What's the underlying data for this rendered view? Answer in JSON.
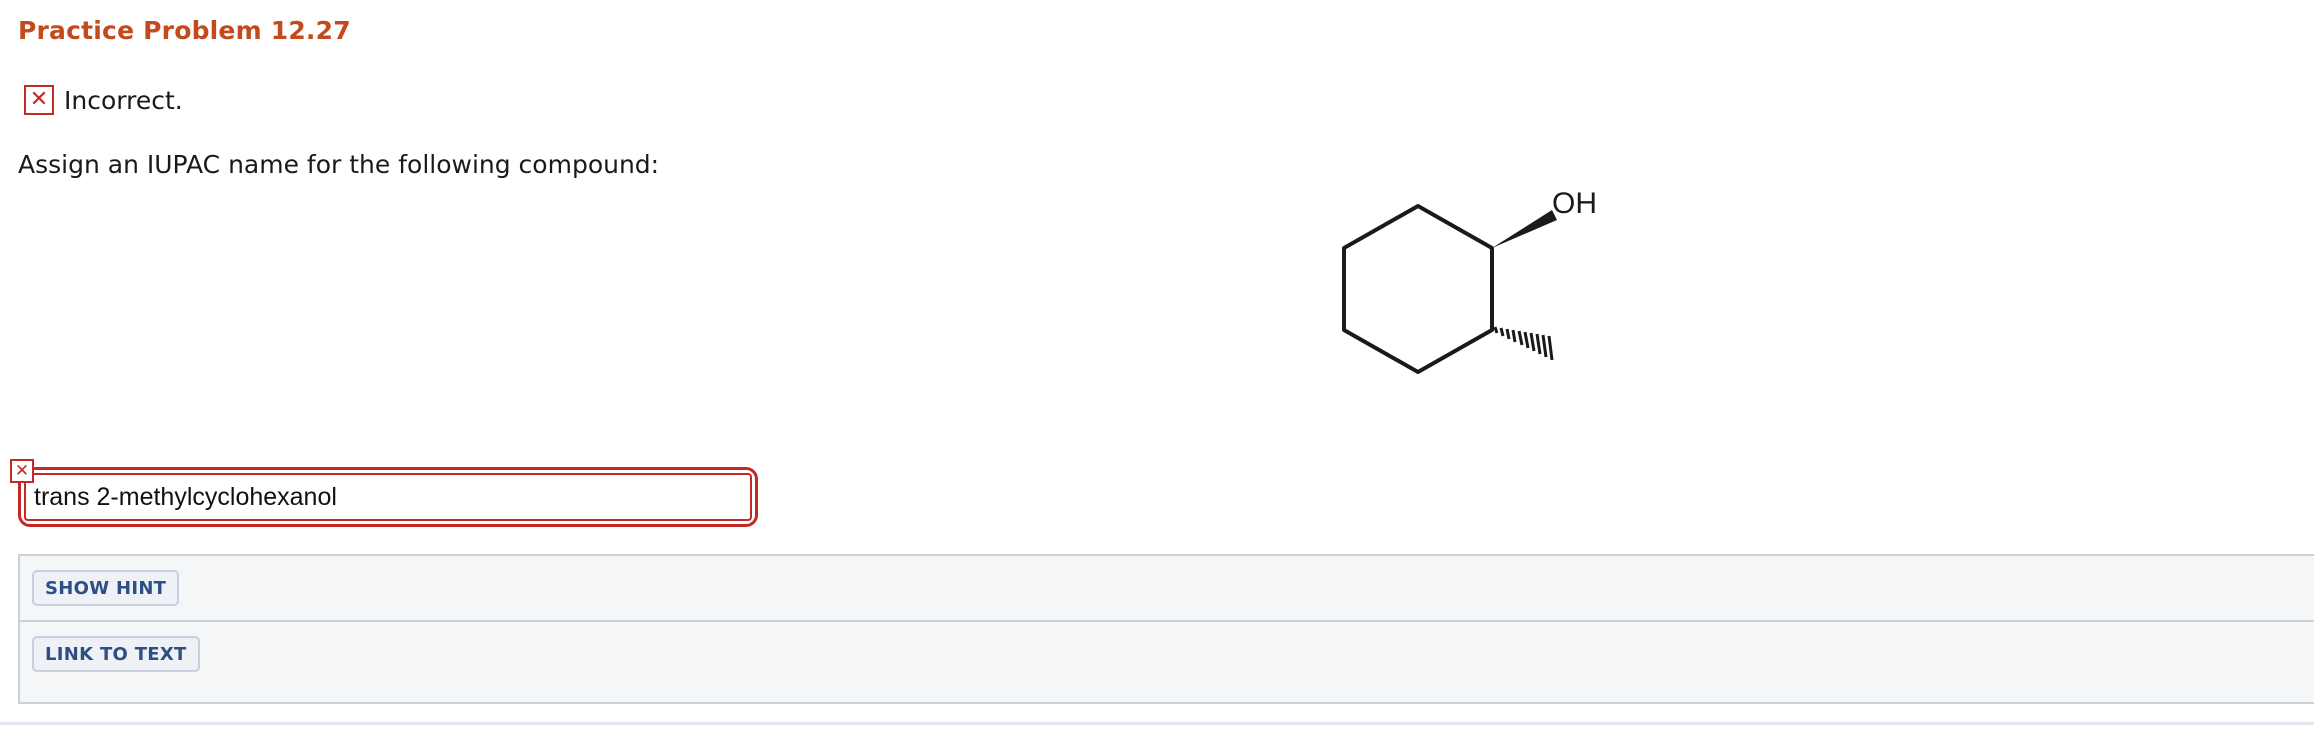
{
  "problem": {
    "title": "Practice Problem 12.27",
    "status_text": "Incorrect.",
    "status_icon": "x-mark-icon",
    "question": "Assign an IUPAC name for the following compound:"
  },
  "molecule": {
    "substituent_label": "OH"
  },
  "answer": {
    "value": "trans 2-methylcyclohexanol",
    "error_icon": "x-mark-icon"
  },
  "tools": {
    "show_hint_label": "SHOW HINT",
    "link_to_text_label": "LINK TO TEXT"
  },
  "colors": {
    "title": "#c4491c",
    "error": "#c62828",
    "button_text": "#2d4f86",
    "panel_bg": "#f5f6f8"
  }
}
